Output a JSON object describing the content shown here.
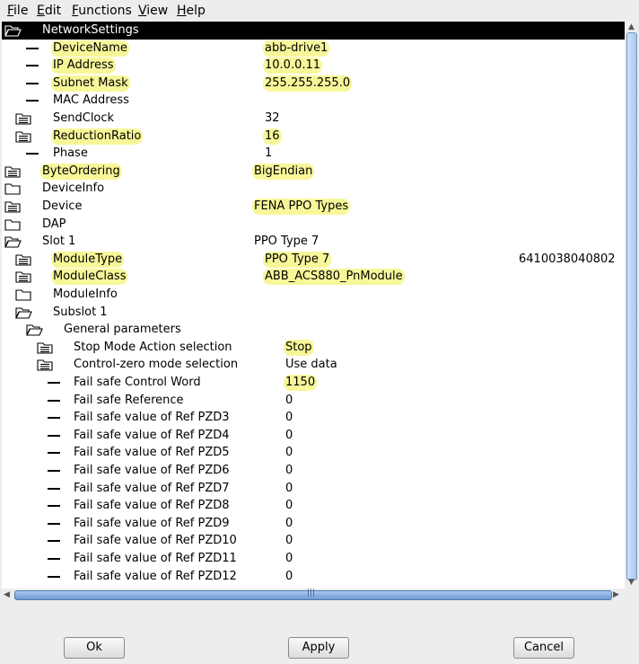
{
  "menubar": {
    "items": [
      {
        "label": "File",
        "mnemonic": "F",
        "rest": "ile"
      },
      {
        "label": "Edit",
        "mnemonic": "E",
        "rest": "dit"
      },
      {
        "label": "Functions",
        "mnemonic": "F",
        "rest": "unctions"
      },
      {
        "label": "View",
        "mnemonic": "V",
        "rest": "iew"
      },
      {
        "label": "Help",
        "mnemonic": "H",
        "rest": "elp"
      }
    ]
  },
  "tree": {
    "rows": [
      {
        "label": "NetworkSettings",
        "value": "",
        "extra": "",
        "icon": "open-folder",
        "level": 0,
        "selected": true,
        "hl_label": false,
        "hl_value": false
      },
      {
        "label": "DeviceName",
        "value": "abb-drive1",
        "extra": "",
        "icon": "leaf-dash",
        "level": 1,
        "hl_label": true,
        "hl_value": true
      },
      {
        "label": "IP Address",
        "value": "10.0.0.11",
        "extra": "",
        "icon": "leaf-dash",
        "level": 1,
        "hl_label": true,
        "hl_value": true
      },
      {
        "label": "Subnet Mask",
        "value": "255.255.255.0",
        "extra": "",
        "icon": "leaf-dash",
        "level": 1,
        "hl_label": true,
        "hl_value": true
      },
      {
        "label": "MAC Address",
        "value": "",
        "extra": "",
        "icon": "leaf-dash",
        "level": 1,
        "hl_label": false,
        "hl_value": false
      },
      {
        "label": "SendClock",
        "value": "32",
        "extra": "",
        "icon": "list-folder",
        "level": 1,
        "hl_label": false,
        "hl_value": false
      },
      {
        "label": "ReductionRatio",
        "value": "16",
        "extra": "",
        "icon": "list-folder",
        "level": 1,
        "hl_label": true,
        "hl_value": true
      },
      {
        "label": "Phase",
        "value": "1",
        "extra": "",
        "icon": "leaf-dash",
        "level": 1,
        "hl_label": false,
        "hl_value": false
      },
      {
        "label": "ByteOrdering",
        "value": "BigEndian",
        "extra": "",
        "icon": "list-folder",
        "level": 0,
        "hl_label": true,
        "hl_value": true
      },
      {
        "label": "DeviceInfo",
        "value": "",
        "extra": "",
        "icon": "closed-folder",
        "level": 0,
        "hl_label": false,
        "hl_value": false
      },
      {
        "label": "Device",
        "value": "FENA PPO Types",
        "extra": "",
        "icon": "list-folder",
        "level": 0,
        "hl_label": false,
        "hl_value": true
      },
      {
        "label": "DAP",
        "value": "",
        "extra": "",
        "icon": "closed-folder",
        "level": 0,
        "hl_label": false,
        "hl_value": false
      },
      {
        "label": "Slot 1",
        "value": "PPO Type 7",
        "extra": "",
        "icon": "open-folder",
        "level": 0,
        "hl_label": false,
        "hl_value": false
      },
      {
        "label": "ModuleType",
        "value": "PPO Type 7",
        "extra": "6410038040802",
        "icon": "list-folder",
        "level": 1,
        "hl_label": true,
        "hl_value": true
      },
      {
        "label": "ModuleClass",
        "value": "ABB_ACS880_PnModule",
        "extra": "",
        "icon": "list-folder",
        "level": 1,
        "hl_label": true,
        "hl_value": true
      },
      {
        "label": "ModuleInfo",
        "value": "",
        "extra": "",
        "icon": "closed-folder",
        "level": 1,
        "hl_label": false,
        "hl_value": false
      },
      {
        "label": "Subslot 1",
        "value": "",
        "extra": "",
        "icon": "open-folder",
        "level": 1,
        "hl_label": false,
        "hl_value": false
      },
      {
        "label": "General parameters",
        "value": "",
        "extra": "",
        "icon": "open-folder",
        "level": 2,
        "hl_label": false,
        "hl_value": false
      },
      {
        "label": "Stop Mode Action selection",
        "value": "Stop",
        "extra": "",
        "icon": "list-folder",
        "level": 3,
        "hl_label": false,
        "hl_value": true
      },
      {
        "label": "Control-zero mode selection",
        "value": "Use data",
        "extra": "",
        "icon": "list-folder",
        "level": 3,
        "hl_label": false,
        "hl_value": false
      },
      {
        "label": "Fail safe Control Word",
        "value": "1150",
        "extra": "",
        "icon": "leaf-dash",
        "level": 3,
        "hl_label": false,
        "hl_value": true
      },
      {
        "label": "Fail safe Reference",
        "value": "0",
        "extra": "",
        "icon": "leaf-dash",
        "level": 3,
        "hl_label": false,
        "hl_value": false
      },
      {
        "label": "Fail safe value of Ref PZD3",
        "value": "0",
        "extra": "",
        "icon": "leaf-dash",
        "level": 3,
        "hl_label": false,
        "hl_value": false
      },
      {
        "label": "Fail safe value of Ref PZD4",
        "value": "0",
        "extra": "",
        "icon": "leaf-dash",
        "level": 3,
        "hl_label": false,
        "hl_value": false
      },
      {
        "label": "Fail safe value of Ref PZD5",
        "value": "0",
        "extra": "",
        "icon": "leaf-dash",
        "level": 3,
        "hl_label": false,
        "hl_value": false
      },
      {
        "label": "Fail safe value of Ref PZD6",
        "value": "0",
        "extra": "",
        "icon": "leaf-dash",
        "level": 3,
        "hl_label": false,
        "hl_value": false
      },
      {
        "label": "Fail safe value of Ref PZD7",
        "value": "0",
        "extra": "",
        "icon": "leaf-dash",
        "level": 3,
        "hl_label": false,
        "hl_value": false
      },
      {
        "label": "Fail safe value of Ref PZD8",
        "value": "0",
        "extra": "",
        "icon": "leaf-dash",
        "level": 3,
        "hl_label": false,
        "hl_value": false
      },
      {
        "label": "Fail safe value of Ref PZD9",
        "value": "0",
        "extra": "",
        "icon": "leaf-dash",
        "level": 3,
        "hl_label": false,
        "hl_value": false
      },
      {
        "label": "Fail safe value of Ref PZD10",
        "value": "0",
        "extra": "",
        "icon": "leaf-dash",
        "level": 3,
        "hl_label": false,
        "hl_value": false
      },
      {
        "label": "Fail safe value of Ref PZD11",
        "value": "0",
        "extra": "",
        "icon": "leaf-dash",
        "level": 3,
        "hl_label": false,
        "hl_value": false
      },
      {
        "label": "Fail safe value of Ref PZD12",
        "value": "0",
        "extra": "",
        "icon": "leaf-dash",
        "level": 3,
        "hl_label": false,
        "hl_value": false
      }
    ]
  },
  "buttons": {
    "ok_label": "Ok",
    "apply_label": "Apply",
    "cancel_label": "Cancel"
  },
  "colors": {
    "highlight": "#f7f79a",
    "selection_bg": "#000000",
    "scrollbar_accent": "#a9c8ee"
  }
}
